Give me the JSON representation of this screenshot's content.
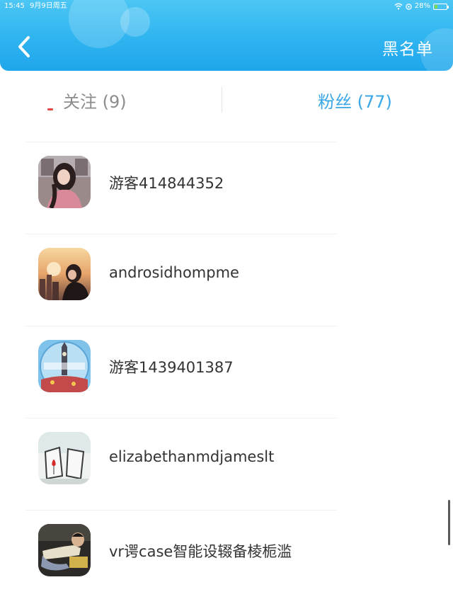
{
  "status_bar": {
    "time": "15:45",
    "date": "9月9日周五",
    "battery_text": "28%",
    "battery_level": 0.28
  },
  "header": {
    "back_icon": "chevron-left-icon",
    "blacklist_label": "黑名单",
    "color": "#2fb4f0"
  },
  "tabs": [
    {
      "label": "关注 (9)",
      "active": false
    },
    {
      "label": "粉丝 (77)",
      "active": true
    }
  ],
  "fans": [
    {
      "name": "游客414844352",
      "avatar": "avatar-girl-dark-hair"
    },
    {
      "name": "androsidhompme",
      "avatar": "avatar-sunset-city"
    },
    {
      "name": "游客1439401387",
      "avatar": "avatar-big-ben-circle"
    },
    {
      "name": "elizabethanmdjameslt",
      "avatar": "avatar-frames-red-flower"
    },
    {
      "name": "vr谔case智能设辍备棱栀滥",
      "avatar": "avatar-boy-lying"
    }
  ],
  "colors": {
    "active_tab": "#3aa6e6",
    "inactive_tab": "#8c8c8c",
    "text": "#333333"
  }
}
